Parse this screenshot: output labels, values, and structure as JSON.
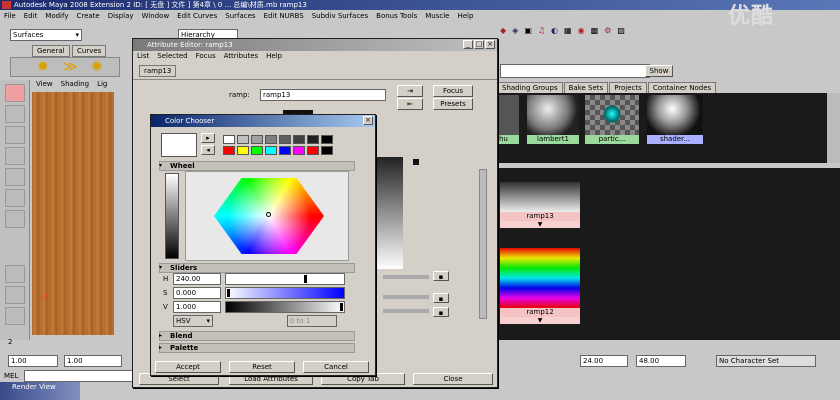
{
  "window": {
    "title": "Autodesk Maya 2008 Extension 2 ID: [ 无盘 ] 文件 ] 第4章 \\ 0 ... 总编\\材质.mb    ramp13"
  },
  "menu": [
    "File",
    "Edit",
    "Modify",
    "Create",
    "Display",
    "Window",
    "Edit Curves",
    "Surfaces",
    "Edit NURBS",
    "Subdiv Surfaces",
    "Bonus Tools",
    "Muscle",
    "Help"
  ],
  "watermark": "优酷",
  "shelf": {
    "mode": "Surfaces",
    "tabs": [
      "General",
      "Curves"
    ],
    "hierarchy": "Hierarchy"
  },
  "viewport_menu": [
    "View",
    "Shading",
    "Lig"
  ],
  "hypershade": {
    "show_btn": "Show",
    "tabs": [
      "Shading Groups",
      "Bake Sets",
      "Projects",
      "Container Nodes"
    ],
    "materials": [
      "hu",
      "lambert1",
      "partic...",
      "shader..."
    ],
    "nodes": [
      "ramp13",
      "ramp12"
    ]
  },
  "attr_editor": {
    "title": "Attribute Editor: ramp13",
    "menu": [
      "List",
      "Selected",
      "Focus",
      "Attributes",
      "Help"
    ],
    "tab": "ramp13",
    "label": "ramp:",
    "value": "ramp13",
    "focus_btn": "Focus",
    "presets_btn": "Presets",
    "bottom_btns": [
      "Select",
      "Load Attributes",
      "Copy Tab",
      "Close"
    ]
  },
  "color_chooser": {
    "title": "Color Chooser",
    "sections": {
      "wheel": "Wheel",
      "sliders": "Sliders",
      "blend": "Blend",
      "palette": "Palette"
    },
    "h_label": "H",
    "h_value": "240.00",
    "s_label": "S",
    "s_value": "0.000",
    "v_label": "V",
    "v_value": "1.000",
    "mode": "HSV",
    "range": "0 to 1",
    "swatches": [
      "#ffffff",
      "#c0c0c0",
      "#a0a0a0",
      "#808080",
      "#606060",
      "#404040",
      "#202020",
      "#000000",
      "#ff0000",
      "#ffff00",
      "#00ff00",
      "#00ffff",
      "#0000ff",
      "#ff00ff",
      "#ff0000",
      "#000000"
    ],
    "buttons": [
      "Accept",
      "Reset",
      "Cancel"
    ]
  },
  "timeline": {
    "start": "1.00",
    "start2": "1.00",
    "tick": "2",
    "end_a": "24.00",
    "end_b": "48.00",
    "character": "No Character Set"
  },
  "cmd": {
    "label": "MEL"
  },
  "render_view": "Render View"
}
